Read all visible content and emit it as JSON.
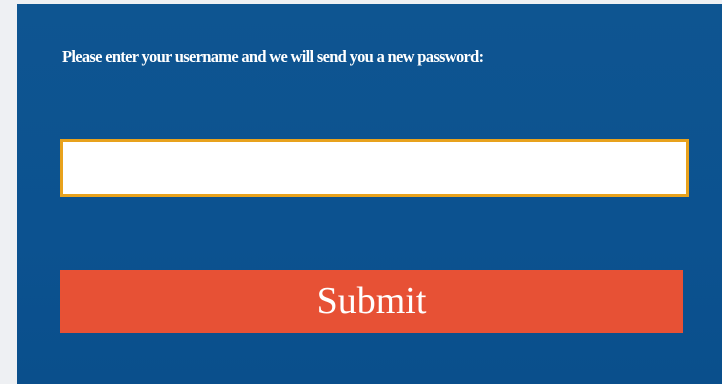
{
  "form": {
    "instructions": "Please enter your username and we will send you a new password:",
    "username_value": "",
    "username_placeholder": "",
    "submit_label": "Submit"
  },
  "colors": {
    "panel_background": "#0c5290",
    "input_border": "#e8a21d",
    "submit_background": "#e75135",
    "page_background": "#eef0f3"
  }
}
